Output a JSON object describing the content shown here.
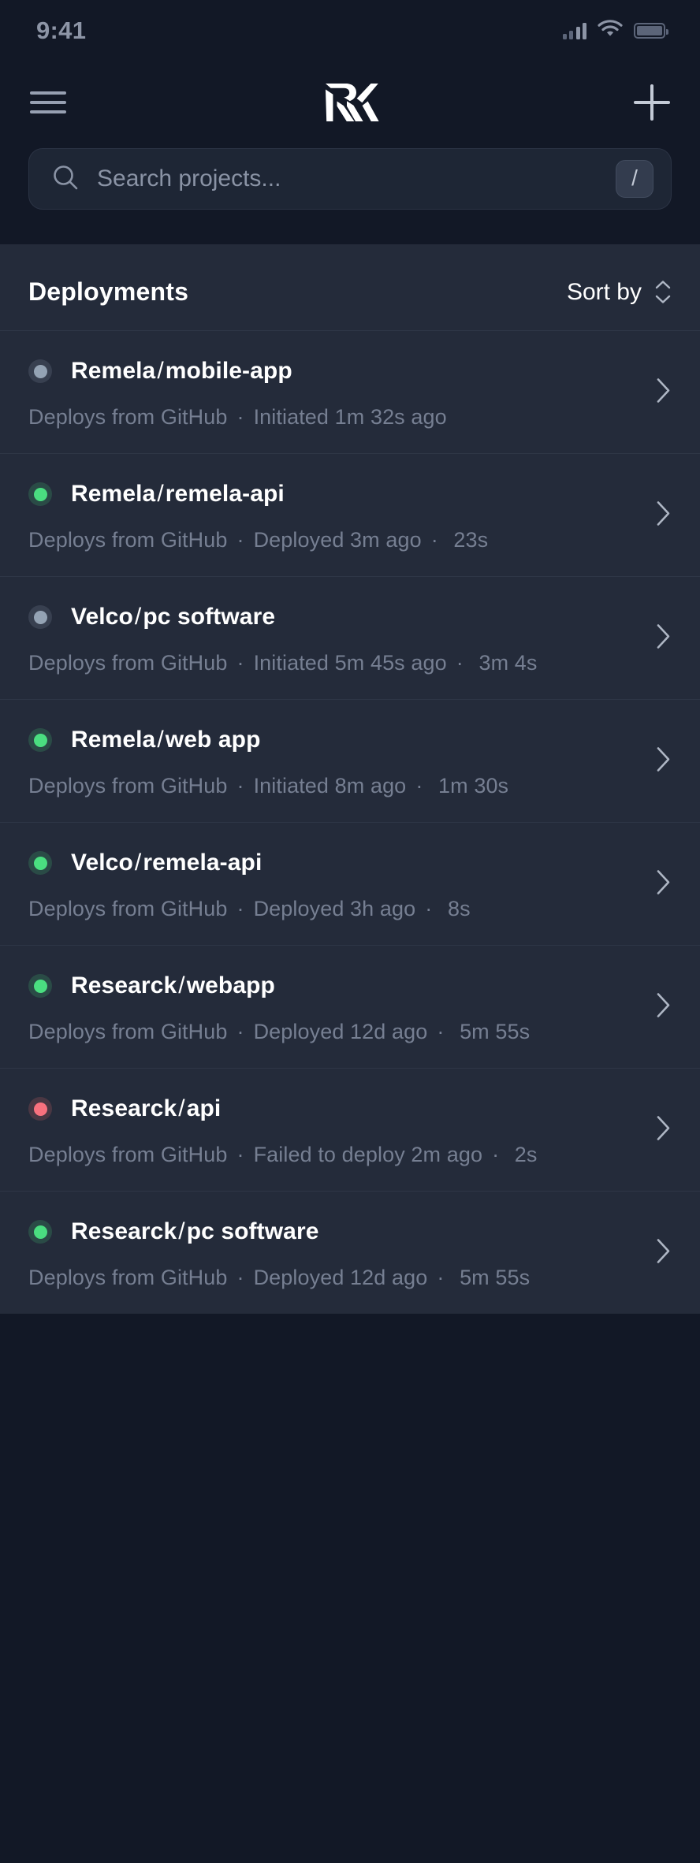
{
  "statusbar": {
    "time": "9:41",
    "signal_icon": "signal-bars-icon",
    "wifi_icon": "wifi-icon",
    "battery_icon": "battery-icon"
  },
  "header": {
    "menu_icon": "hamburger-menu-icon",
    "logo": "rk-logo",
    "add_icon": "plus-icon"
  },
  "search": {
    "icon": "search-icon",
    "placeholder": "Search projects...",
    "value": "",
    "shortcut_key": "/"
  },
  "section": {
    "title": "Deployments",
    "sort_label": "Sort by",
    "sort_icon": "chevron-up-down-icon"
  },
  "colors": {
    "background": "#121826",
    "content_background": "#242B3A",
    "success": "#4ADE80",
    "failed": "#F8717E",
    "pending": "#94A3B4",
    "text_primary": "#FFFFFF",
    "text_muted": "#767F92"
  },
  "deployments": [
    {
      "status": "pending",
      "org": "Remela",
      "separator": "/",
      "project": "mobile-app",
      "source": "Deploys from GitHub",
      "state": "Initiated 1m 32s ago",
      "duration": "",
      "chevron_icon": "chevron-right-icon"
    },
    {
      "status": "success",
      "org": "Remela",
      "separator": "/",
      "project": "remela-api",
      "source": "Deploys from GitHub",
      "state": "Deployed 3m ago",
      "duration": "23s",
      "chevron_icon": "chevron-right-icon"
    },
    {
      "status": "pending",
      "org": "Velco",
      "separator": "/",
      "project": "pc software",
      "source": "Deploys from GitHub",
      "state": "Initiated 5m 45s ago",
      "duration": "3m 4s",
      "chevron_icon": "chevron-right-icon"
    },
    {
      "status": "success",
      "org": "Remela",
      "separator": "/",
      "project": "web app",
      "source": "Deploys from GitHub",
      "state": "Initiated 8m ago",
      "duration": "1m 30s",
      "chevron_icon": "chevron-right-icon"
    },
    {
      "status": "success",
      "org": "Velco",
      "separator": "/",
      "project": "remela-api",
      "source": "Deploys from GitHub",
      "state": "Deployed 3h ago",
      "duration": "8s",
      "chevron_icon": "chevron-right-icon"
    },
    {
      "status": "success",
      "org": "Researck",
      "separator": "/",
      "project": "webapp",
      "source": "Deploys from GitHub",
      "state": "Deployed 12d ago",
      "duration": "5m 55s",
      "chevron_icon": "chevron-right-icon"
    },
    {
      "status": "failed",
      "org": "Researck",
      "separator": "/",
      "project": "api",
      "source": "Deploys from GitHub",
      "state": "Failed to deploy 2m ago",
      "duration": "2s",
      "chevron_icon": "chevron-right-icon"
    },
    {
      "status": "success",
      "org": "Researck",
      "separator": "/",
      "project": "pc software",
      "source": "Deploys from GitHub",
      "state": "Deployed 12d ago",
      "duration": "5m 55s",
      "chevron_icon": "chevron-right-icon"
    }
  ]
}
